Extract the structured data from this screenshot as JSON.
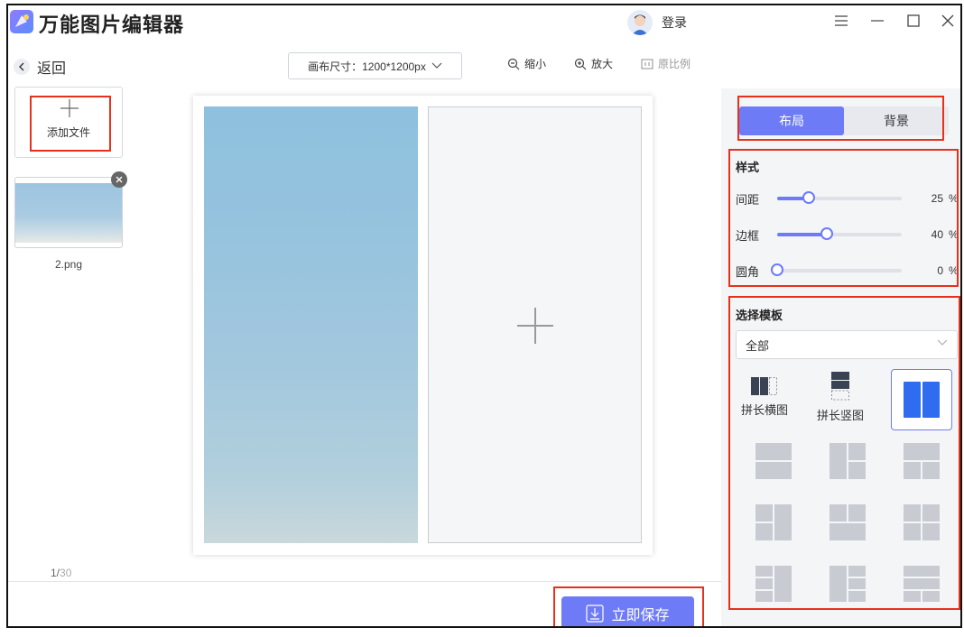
{
  "app": {
    "title": "万能图片编辑器",
    "login_label": "登录"
  },
  "toolbar": {
    "back_label": "返回",
    "canvas_size_label": "画布尺寸：1200*1200px",
    "zoom_out_label": "缩小",
    "zoom_in_label": "放大",
    "original_ratio_label": "原比例"
  },
  "left_panel": {
    "add_file_label": "添加文件",
    "files": [
      {
        "name": "2.png"
      }
    ],
    "page_current": "1/",
    "page_total": "30"
  },
  "save_label": "立即保存",
  "right_panel": {
    "tabs": [
      {
        "label": "布局",
        "active": true
      },
      {
        "label": "背景",
        "active": false
      }
    ],
    "style_title": "样式",
    "sliders": [
      {
        "label": "间距",
        "value": 25,
        "unit": "%"
      },
      {
        "label": "边框",
        "value": 40,
        "unit": "%"
      },
      {
        "label": "圆角",
        "value": 0,
        "unit": "%"
      }
    ],
    "template_title": "选择模板",
    "template_filter": "全部",
    "templates": [
      {
        "label": "拼长横图"
      },
      {
        "label": "拼长竖图"
      }
    ]
  },
  "colors": {
    "accent": "#6e7bf7",
    "highlight_box": "#e8301c"
  }
}
